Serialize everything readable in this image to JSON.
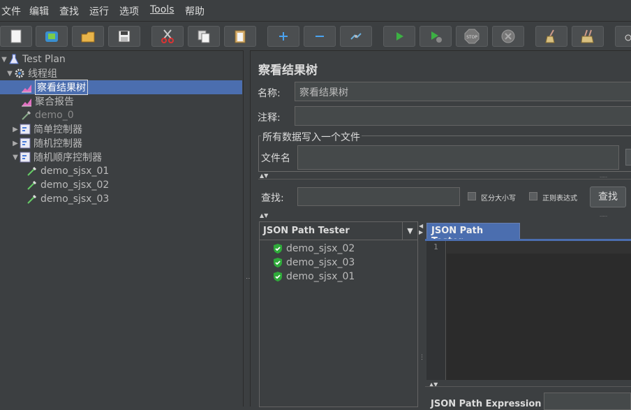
{
  "menu": {
    "file": "文件",
    "edit": "编辑",
    "search": "查找",
    "run": "运行",
    "options": "选项",
    "tools": "Tools",
    "help": "帮助"
  },
  "tree": {
    "test_plan": "Test Plan",
    "thread_group": "线程组",
    "view_results_tree": "察看结果树",
    "aggregate_report": "聚合报告",
    "demo0": "demo_0",
    "simple_controller": "简单控制器",
    "random_controller": "随机控制器",
    "random_order_controller": "随机顺序控制器",
    "demo1": "demo_sjsx_01",
    "demo2": "demo_sjsx_02",
    "demo3": "demo_sjsx_03"
  },
  "panel": {
    "title": "察看结果树",
    "name_label": "名称:",
    "name_value": "察看结果树",
    "comment_label": "注释:",
    "comment_value": "",
    "file_group_label": "所有数据写入一个文件",
    "filename_label": "文件名",
    "filename_value": "",
    "search_label": "查找:",
    "search_value": "",
    "case_sensitive": "区分大小写",
    "regex": "正则表达式",
    "search_button": "查找",
    "renderer_select": "JSON Path Tester",
    "results": [
      "demo_sjsx_02",
      "demo_sjsx_03",
      "demo_sjsx_01"
    ],
    "tab_label": "JSON Path Tester",
    "line_number": "1",
    "expr_label": "JSON Path Expression",
    "expr_value": ""
  }
}
